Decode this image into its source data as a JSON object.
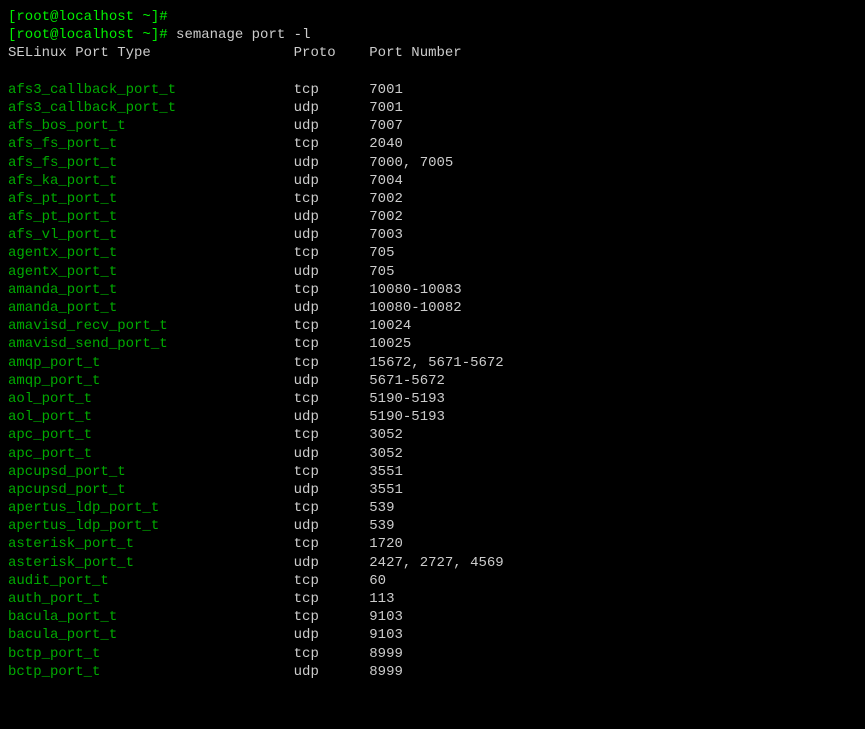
{
  "prompt1": {
    "prefix": "[root@localhost ~]#"
  },
  "prompt2": {
    "prefix": "[root@localhost ~]#",
    "command": " semanage port -l"
  },
  "header": {
    "col1": "SELinux Port Type",
    "col2": "Proto",
    "col3": "Port Number"
  },
  "rows": [
    {
      "type": "afs3_callback_port_t",
      "proto": "tcp",
      "ports": "7001"
    },
    {
      "type": "afs3_callback_port_t",
      "proto": "udp",
      "ports": "7001"
    },
    {
      "type": "afs_bos_port_t",
      "proto": "udp",
      "ports": "7007"
    },
    {
      "type": "afs_fs_port_t",
      "proto": "tcp",
      "ports": "2040"
    },
    {
      "type": "afs_fs_port_t",
      "proto": "udp",
      "ports": "7000, 7005"
    },
    {
      "type": "afs_ka_port_t",
      "proto": "udp",
      "ports": "7004"
    },
    {
      "type": "afs_pt_port_t",
      "proto": "tcp",
      "ports": "7002"
    },
    {
      "type": "afs_pt_port_t",
      "proto": "udp",
      "ports": "7002"
    },
    {
      "type": "afs_vl_port_t",
      "proto": "udp",
      "ports": "7003"
    },
    {
      "type": "agentx_port_t",
      "proto": "tcp",
      "ports": "705"
    },
    {
      "type": "agentx_port_t",
      "proto": "udp",
      "ports": "705"
    },
    {
      "type": "amanda_port_t",
      "proto": "tcp",
      "ports": "10080-10083"
    },
    {
      "type": "amanda_port_t",
      "proto": "udp",
      "ports": "10080-10082"
    },
    {
      "type": "amavisd_recv_port_t",
      "proto": "tcp",
      "ports": "10024"
    },
    {
      "type": "amavisd_send_port_t",
      "proto": "tcp",
      "ports": "10025"
    },
    {
      "type": "amqp_port_t",
      "proto": "tcp",
      "ports": "15672, 5671-5672"
    },
    {
      "type": "amqp_port_t",
      "proto": "udp",
      "ports": "5671-5672"
    },
    {
      "type": "aol_port_t",
      "proto": "tcp",
      "ports": "5190-5193"
    },
    {
      "type": "aol_port_t",
      "proto": "udp",
      "ports": "5190-5193"
    },
    {
      "type": "apc_port_t",
      "proto": "tcp",
      "ports": "3052"
    },
    {
      "type": "apc_port_t",
      "proto": "udp",
      "ports": "3052"
    },
    {
      "type": "apcupsd_port_t",
      "proto": "tcp",
      "ports": "3551"
    },
    {
      "type": "apcupsd_port_t",
      "proto": "udp",
      "ports": "3551"
    },
    {
      "type": "apertus_ldp_port_t",
      "proto": "tcp",
      "ports": "539"
    },
    {
      "type": "apertus_ldp_port_t",
      "proto": "udp",
      "ports": "539"
    },
    {
      "type": "asterisk_port_t",
      "proto": "tcp",
      "ports": "1720"
    },
    {
      "type": "asterisk_port_t",
      "proto": "udp",
      "ports": "2427, 2727, 4569"
    },
    {
      "type": "audit_port_t",
      "proto": "tcp",
      "ports": "60"
    },
    {
      "type": "auth_port_t",
      "proto": "tcp",
      "ports": "113"
    },
    {
      "type": "bacula_port_t",
      "proto": "tcp",
      "ports": "9103"
    },
    {
      "type": "bacula_port_t",
      "proto": "udp",
      "ports": "9103"
    },
    {
      "type": "bctp_port_t",
      "proto": "tcp",
      "ports": "8999"
    },
    {
      "type": "bctp_port_t",
      "proto": "udp",
      "ports": "8999"
    }
  ]
}
